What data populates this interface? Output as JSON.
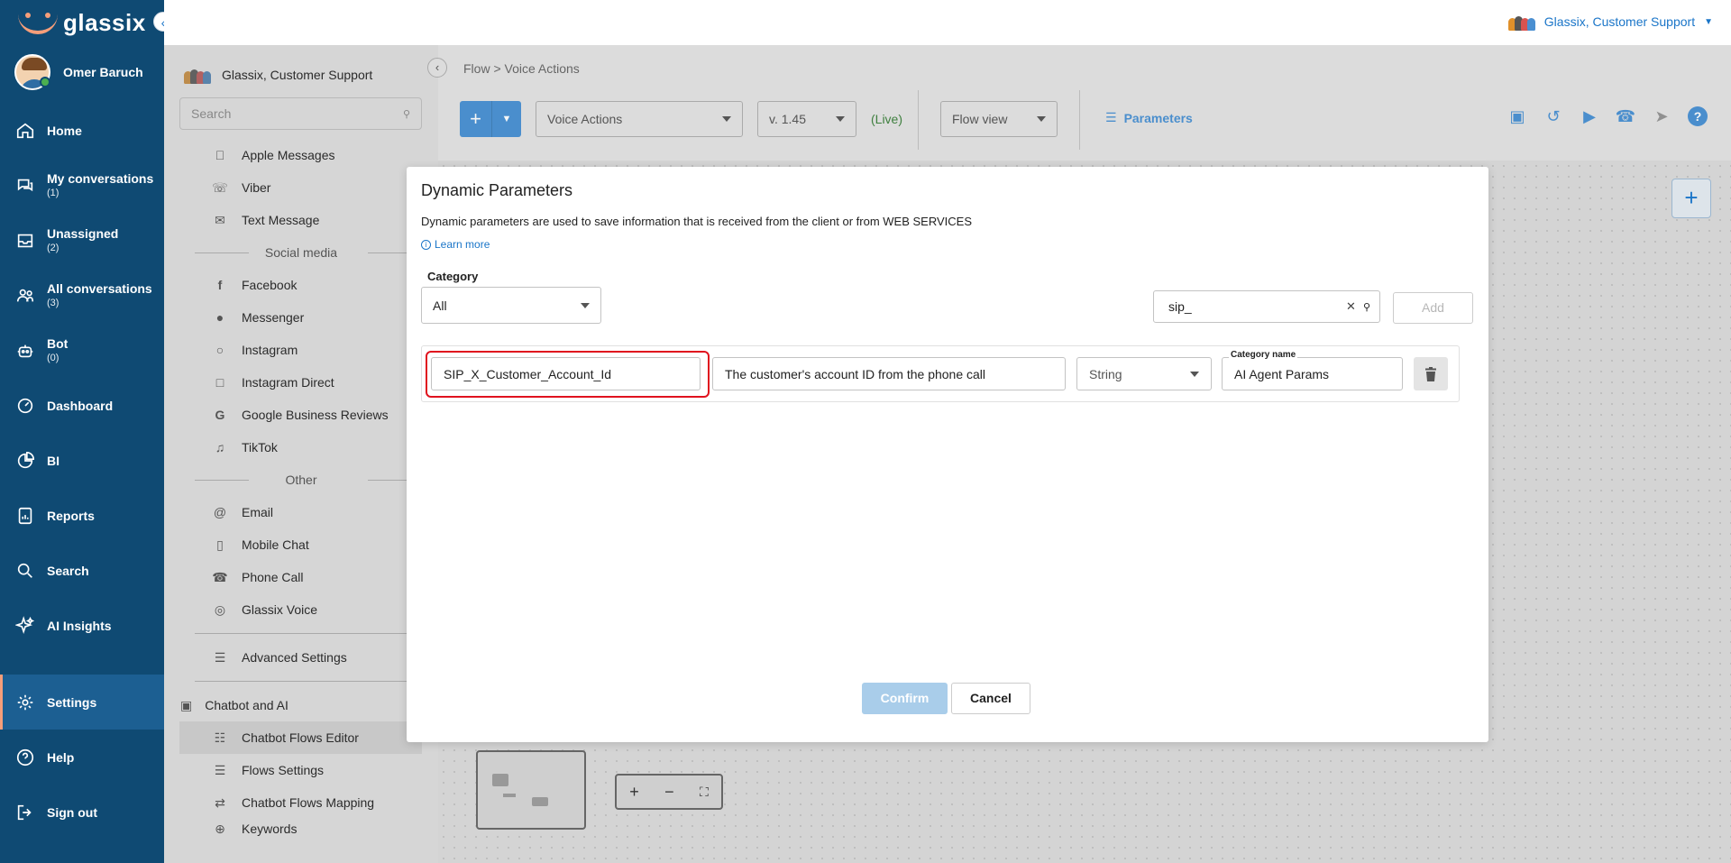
{
  "brand": {
    "name": "glassix"
  },
  "user": {
    "name": "Omer Baruch"
  },
  "nav": [
    {
      "label": "Home",
      "icon": "home-icon"
    },
    {
      "label": "My conversations",
      "count": "(1)",
      "icon": "chat-icon"
    },
    {
      "label": "Unassigned",
      "count": "(2)",
      "icon": "inbox-icon"
    },
    {
      "label": "All conversations",
      "count": "(3)",
      "icon": "users-icon"
    },
    {
      "label": "Bot",
      "count": "(0)",
      "icon": "bot-icon"
    },
    {
      "label": "Dashboard",
      "icon": "gauge-icon"
    },
    {
      "label": "BI",
      "icon": "pie-icon"
    },
    {
      "label": "Reports",
      "icon": "report-icon"
    },
    {
      "label": "Search",
      "icon": "search-icon"
    },
    {
      "label": "AI Insights",
      "icon": "sparkle-icon"
    },
    {
      "label": "Settings",
      "icon": "gear-icon",
      "active": true
    },
    {
      "label": "Help",
      "icon": "help-icon"
    },
    {
      "label": "Sign out",
      "icon": "signout-icon"
    }
  ],
  "topbar": {
    "account": "Glassix, Customer Support"
  },
  "settings": {
    "account": "Glassix, Customer Support",
    "search_placeholder": "Search",
    "messaging": [
      "Apple Messages",
      "Viber",
      "Text Message"
    ],
    "social_header": "Social media",
    "social": [
      "Facebook",
      "Messenger",
      "Instagram",
      "Instagram Direct",
      "Google Business Reviews",
      "TikTok"
    ],
    "other_header": "Other",
    "other": [
      "Email",
      "Mobile Chat",
      "Phone Call",
      "Glassix Voice"
    ],
    "advanced": "Advanced Settings",
    "chatbot_header": "Chatbot and AI",
    "chatbot": [
      "Chatbot Flows Editor",
      "Flows Settings",
      "Chatbot Flows Mapping",
      "Keywords"
    ]
  },
  "editor": {
    "breadcrumb": "Flow  >  Voice Actions",
    "flow_select": "Voice Actions",
    "version": "v. 1.45",
    "live": "(Live)",
    "view_select": "Flow view",
    "parameters": "Parameters"
  },
  "modal": {
    "title": "Dynamic Parameters",
    "description": "Dynamic parameters are used to save information that is received from the client or from WEB SERVICES",
    "learn_more": "Learn more",
    "category_label": "Category",
    "category_value": "All",
    "search_value": "sip_",
    "add_label": "Add",
    "row": {
      "name": "SIP_X_Customer_Account_Id",
      "description": "The customer's account ID from the phone call",
      "type": "String",
      "category_label": "Category name",
      "category": "AI Agent Params"
    },
    "confirm": "Confirm",
    "cancel": "Cancel"
  },
  "colors": {
    "nav_bg": "#0f4a73",
    "accent": "#1a75c8",
    "highlight": "#e0121e",
    "live": "#3e7f3e"
  }
}
